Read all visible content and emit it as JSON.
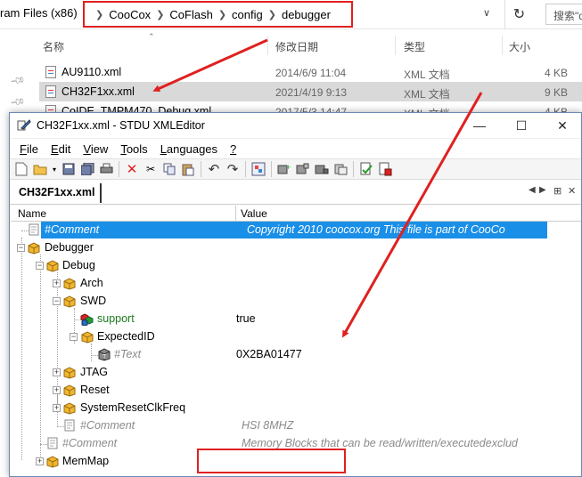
{
  "explorer": {
    "path_lead": "ram Files (x86)",
    "breadcrumbs": [
      "CooCox",
      "CoFlash",
      "config",
      "debugger"
    ],
    "refresh_icon": "refresh-icon",
    "search_placeholder": "搜索\"de",
    "columns": {
      "name": "名称",
      "date": "修改日期",
      "type": "类型",
      "size": "大小"
    },
    "files": [
      {
        "name": "AU9110.xml",
        "date": "2014/6/9 11:04",
        "type": "XML 文档",
        "size": "4 KB"
      },
      {
        "name": "CH32F1xx.xml",
        "date": "2021/4/19 9:13",
        "type": "XML 文档",
        "size": "9 KB"
      },
      {
        "name": "CoIDE_TMPM470_Debug.xml",
        "date": "2017/5/3 14:47",
        "type": "XML 文档",
        "size": "4 KB"
      }
    ]
  },
  "editor": {
    "title": "CH32F1xx.xml - STDU XMLEditor",
    "menu": [
      {
        "key": "F",
        "rest": "ile"
      },
      {
        "key": "E",
        "rest": "dit"
      },
      {
        "key": "V",
        "rest": "iew"
      },
      {
        "key": "T",
        "rest": "ools"
      },
      {
        "key": "L",
        "rest": "anguages"
      },
      {
        "key": "?",
        "rest": ""
      }
    ],
    "tab": "CH32F1xx.xml",
    "columns": {
      "name": "Name",
      "value": "Value"
    },
    "tree": {
      "comment1": {
        "name": "#Comment",
        "value": "Copyright 2010 coocox.org  This file is part of CooCo"
      },
      "debugger": "Debugger",
      "debug": "Debug",
      "arch": "Arch",
      "swd": "SWD",
      "support": {
        "name": "support",
        "value": "true"
      },
      "expected_id": "ExpectedID",
      "text_node": {
        "name": "#Text",
        "value": "0X2BA01477"
      },
      "jtag": "JTAG",
      "reset": "Reset",
      "sysreset": "SystemResetClkFreq",
      "comment2": {
        "name": "#Comment",
        "value": "HSI 8MHZ"
      },
      "comment3": {
        "name": "#Comment",
        "value": "Memory Blocks that can be read/written/executedexclud"
      },
      "memmap": "MemMap"
    }
  },
  "colors": {
    "highlight": "#e02020",
    "selection": "#1a8fe8"
  }
}
